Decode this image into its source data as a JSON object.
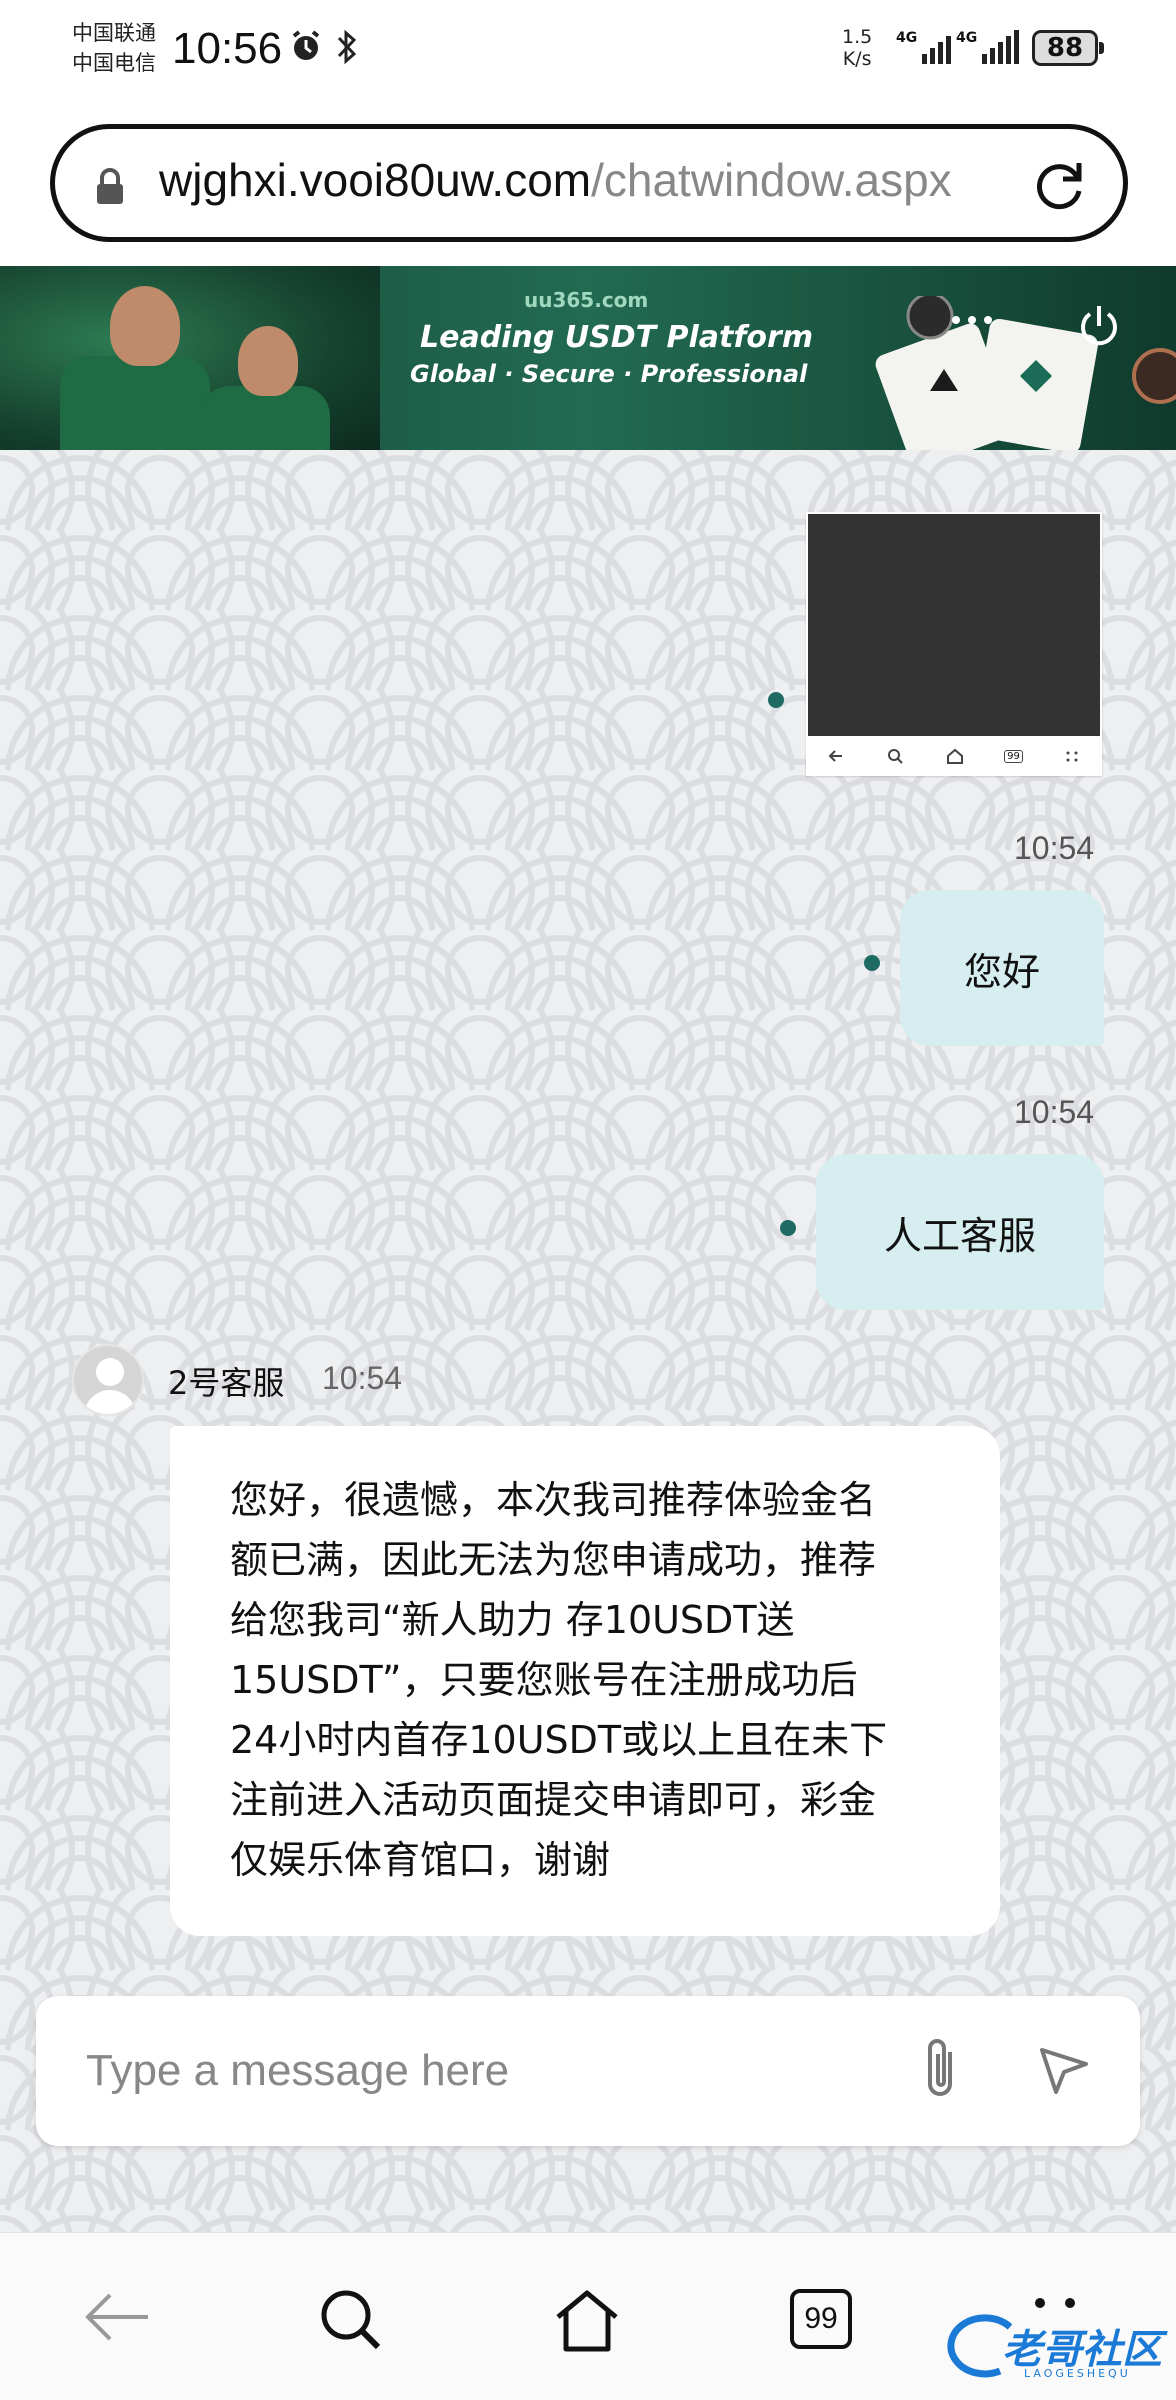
{
  "status_bar": {
    "carrier_1": "中国联通",
    "carrier_2": "中国电信",
    "time": "10:56",
    "net_speed_value": "1.5",
    "net_speed_unit": "K/s",
    "sim1_tag": "4G",
    "sim2_tag": "4G",
    "battery": "88"
  },
  "browser": {
    "url_domain": "wjghxi.vooi80uw.com",
    "url_path": "/chatwindow.aspx"
  },
  "banner": {
    "site": "uu365.com",
    "headline": "Leading USDT Platform",
    "subline": "Global · Secure · Professional"
  },
  "chat": {
    "messages_out": [
      {
        "time": "10:54",
        "text": "您好"
      },
      {
        "time": "10:54",
        "text": "人工客服"
      }
    ],
    "agent": {
      "name": "2号客服",
      "time": "10:54",
      "lines": [
        "您好，很遗憾，本次我司推荐体验金名",
        "额已满，因此无法为您申请成功，推荐",
        "给您我司“新人助力 存10USDT送",
        "15USDT”，只要您账号在注册成功后",
        "24小时内首存10USDT或以上且在未下",
        "注前进入活动页面提交申请即可，彩金",
        "仅娱乐体育馆口，谢谢"
      ]
    },
    "composer_placeholder": "Type a message here",
    "thumb_badge": "99"
  },
  "bottom_nav": {
    "tabs_count": "99"
  },
  "watermark": {
    "text": "老哥社区",
    "sub": "LAOGESHEQU"
  }
}
